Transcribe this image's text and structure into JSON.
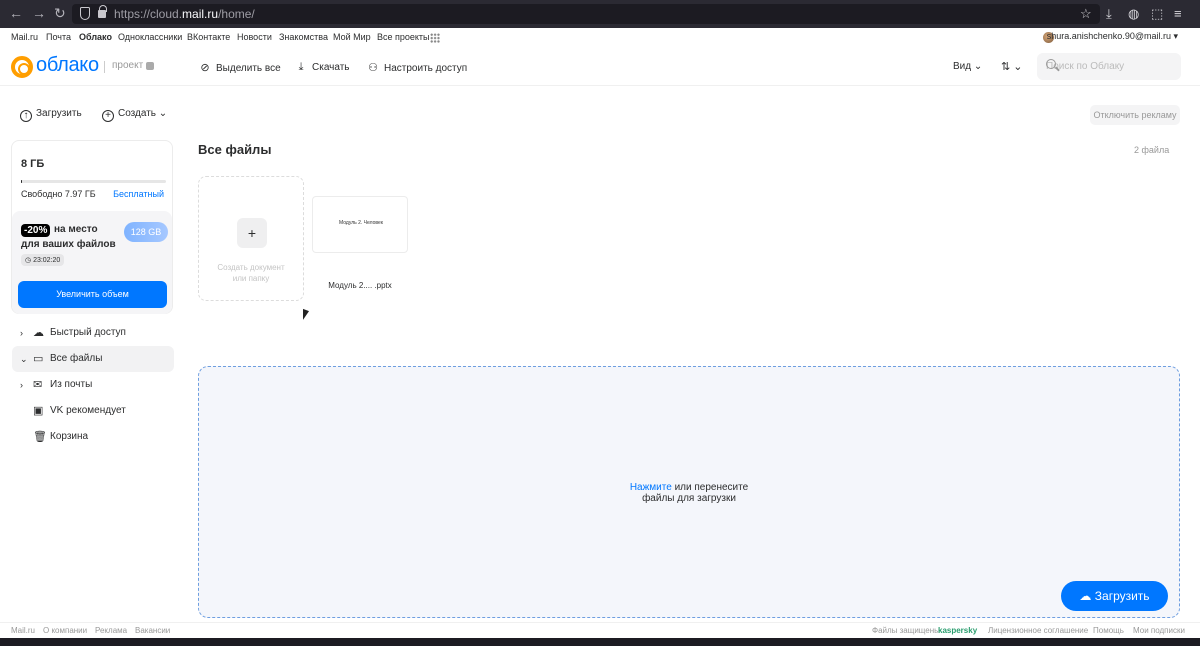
{
  "browser": {
    "url_prefix": "https://cloud.",
    "url_host": "mail.ru",
    "url_path": "/home/"
  },
  "portal": {
    "links": [
      "Mail.ru",
      "Почта",
      "Облако",
      "Одноклассники",
      "ВКонтакте",
      "Новости",
      "Знакомства",
      "Мой Мир",
      "Все проекты"
    ],
    "user": "shura.anishchenko.90@mail.ru"
  },
  "header": {
    "logo": "облако",
    "project": "проект",
    "select_all": "Выделить все",
    "download": "Скачать",
    "share": "Настроить доступ",
    "view": "Вид",
    "search_placeholder": "Поиск по Облаку"
  },
  "actions": {
    "upload": "Загрузить",
    "create": "Создать",
    "disable_ads": "Отключить рекламу"
  },
  "storage": {
    "total": "8 ГБ",
    "used_fraction": 0.003,
    "free": "Свободно 7.97 ГБ",
    "plan": "Бесплатный",
    "promo_discount": "-20%",
    "promo_line1": "на место",
    "promo_line2": "для ваших файлов",
    "promo_size": "128 GB",
    "timer": "23:02:20",
    "increase_button": "Увеличить объем"
  },
  "tree": [
    {
      "label": "Быстрый доступ",
      "icon": "cloud-icon",
      "chevron": "›"
    },
    {
      "label": "Все файлы",
      "icon": "folder-icon",
      "chevron": "⌄"
    },
    {
      "label": "Из почты",
      "icon": "mail-icon",
      "chevron": "›"
    },
    {
      "label": "VK рекомендует",
      "icon": "vk-icon",
      "chevron": ""
    },
    {
      "label": "Корзина",
      "icon": "trash-icon",
      "chevron": ""
    }
  ],
  "main": {
    "title": "Все файлы",
    "count": "2 файла",
    "new_doc_line1": "Создать документ",
    "new_doc_line2": "или папку",
    "file_preview_text": "Модуль 2. Человек",
    "file_name": "Модуль 2.... .pptx",
    "drop_link": "Нажмите",
    "drop_text1": " или перенесите",
    "drop_text2": "файлы для загрузки",
    "fab_upload": "Загрузить"
  },
  "footer": {
    "left": [
      "Mail.ru",
      "О компании",
      "Реклама",
      "Вакансии"
    ],
    "protected": "Файлы защищены",
    "kaspersky": "kaspersky",
    "right": [
      "Лицензионное соглашение",
      "Помощь",
      "Мои подписки"
    ]
  }
}
